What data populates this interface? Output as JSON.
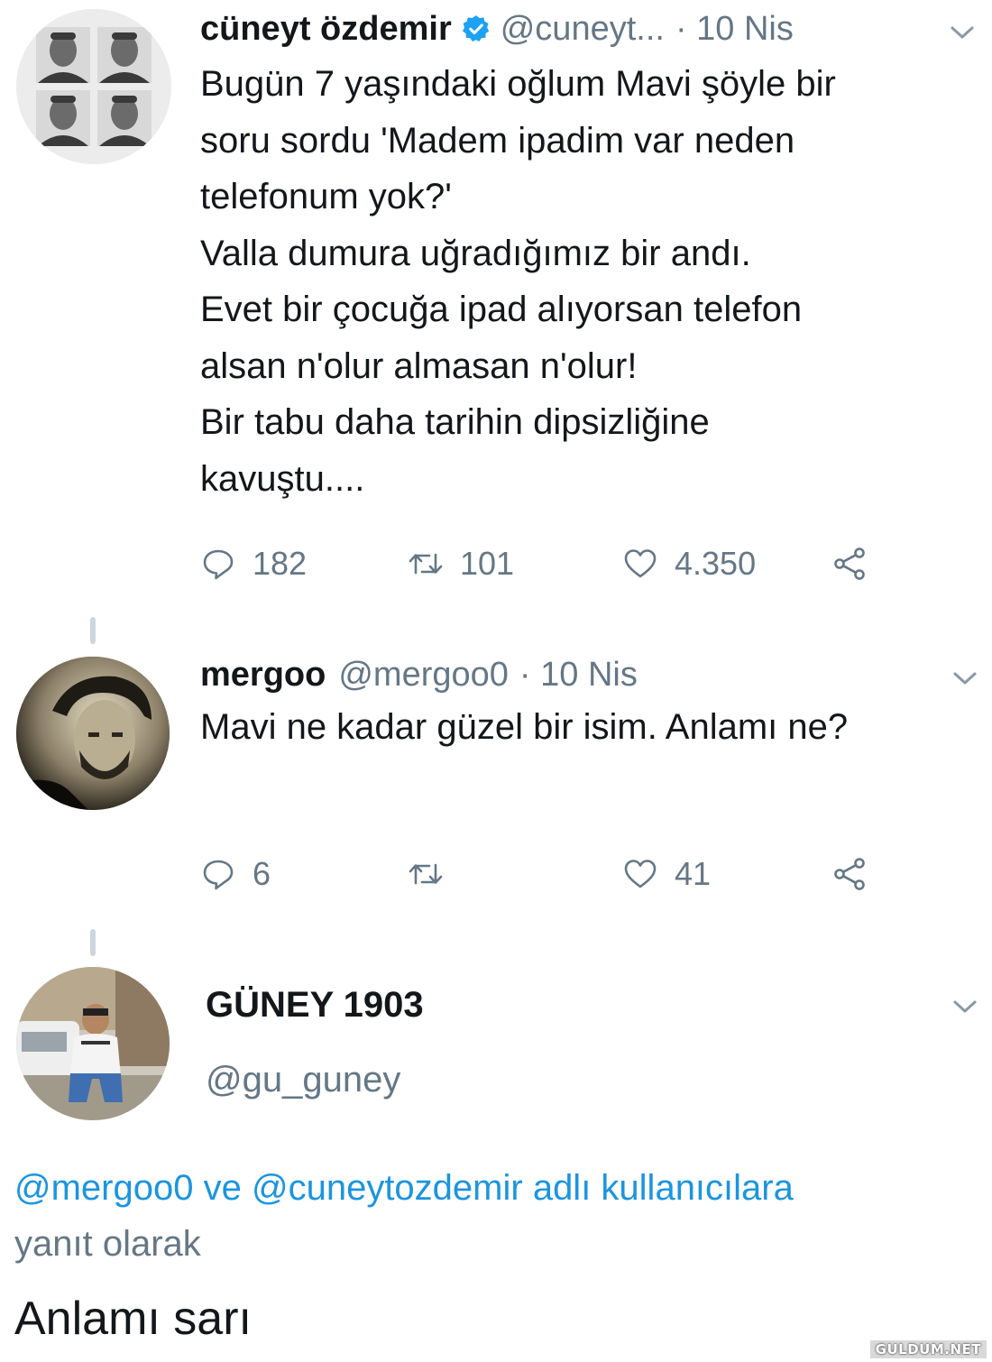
{
  "tweets": [
    {
      "name": "cüneyt özdemir",
      "handle": "@cuneyt...",
      "date": "· 10 Nis",
      "verified": true,
      "text_lines": [
        "Bugün 7 yaşındaki oğlum Mavi şöyle bir",
        "soru sordu 'Madem ipadim var neden",
        "telefonum yok?'",
        "Valla dumura uğradığımız bir andı.",
        "Evet bir çocuğa ipad alıyorsan telefon",
        "alsan n'olur almasan n'olur!",
        "Bir tabu daha tarihin dipsizliğine",
        "kavuştu...."
      ],
      "stats": {
        "replies": "182",
        "retweets": "101",
        "likes": "4.350"
      }
    },
    {
      "name": "mergoo",
      "handle": "@mergoo0",
      "date": "· 10 Nis",
      "text": "Mavi ne kadar güzel bir isim. Anlamı ne?",
      "stats": {
        "replies": "6",
        "retweets": "",
        "likes": "41"
      }
    },
    {
      "name": "GÜNEY 1903",
      "handle": "@gu_guney",
      "reply_to": {
        "mention1": "@mergoo0",
        "connector": " ve ",
        "mention2": "@cuneytozdemir",
        "suffix_blue": " adlı kullanıcılara",
        "suffix_gray": "yanıt olarak"
      },
      "text": "Anlamı sarı"
    }
  ],
  "icons": {
    "reply": "reply-icon",
    "retweet": "retweet-icon",
    "like": "heart-icon",
    "share": "share-icon",
    "verified": "verified-badge-icon",
    "caret": "chevron-down-icon"
  },
  "colors": {
    "text": "#14171a",
    "secondary": "#657786",
    "link": "#1b95e0",
    "verified": "#1da1f2"
  },
  "watermark": "GULDUM.NET"
}
